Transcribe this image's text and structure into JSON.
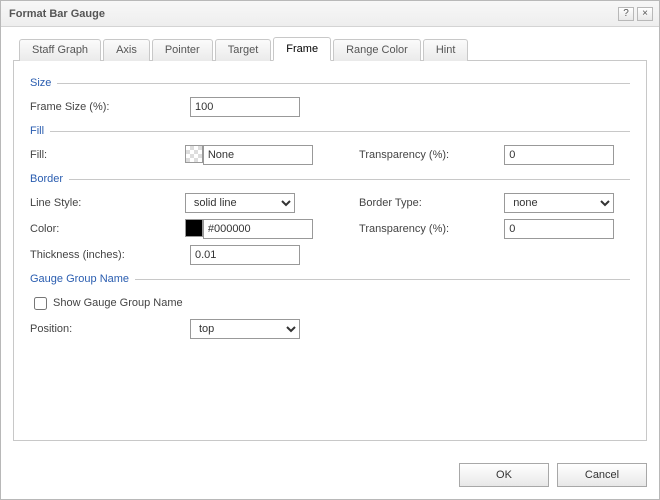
{
  "window": {
    "title": "Format Bar Gauge",
    "help_label": "?",
    "close_label": "×"
  },
  "tabs": [
    {
      "id": "staff-graph",
      "label": "Staff Graph"
    },
    {
      "id": "axis",
      "label": "Axis"
    },
    {
      "id": "pointer",
      "label": "Pointer"
    },
    {
      "id": "target",
      "label": "Target"
    },
    {
      "id": "frame",
      "label": "Frame"
    },
    {
      "id": "range-color",
      "label": "Range Color"
    },
    {
      "id": "hint",
      "label": "Hint"
    }
  ],
  "active_tab": "frame",
  "sections": {
    "size": {
      "title": "Size",
      "frame_size_label": "Frame Size (%):",
      "frame_size_value": "100"
    },
    "fill": {
      "title": "Fill",
      "fill_label": "Fill:",
      "fill_value": "None",
      "transparency_label": "Transparency (%):",
      "transparency_value": "0"
    },
    "border": {
      "title": "Border",
      "line_style_label": "Line Style:",
      "line_style_value": "solid line",
      "line_style_options": [
        "solid line"
      ],
      "border_type_label": "Border Type:",
      "border_type_value": "none",
      "border_type_options": [
        "none"
      ],
      "color_label": "Color:",
      "color_value": "#000000",
      "transparency_label": "Transparency (%):",
      "transparency_value": "0",
      "thickness_label": "Thickness (inches):",
      "thickness_value": "0.01"
    },
    "group": {
      "title": "Gauge Group Name",
      "show_label": "Show Gauge Group Name",
      "show_checked": false,
      "position_label": "Position:",
      "position_value": "top",
      "position_options": [
        "top"
      ]
    }
  },
  "buttons": {
    "ok": "OK",
    "cancel": "Cancel"
  }
}
